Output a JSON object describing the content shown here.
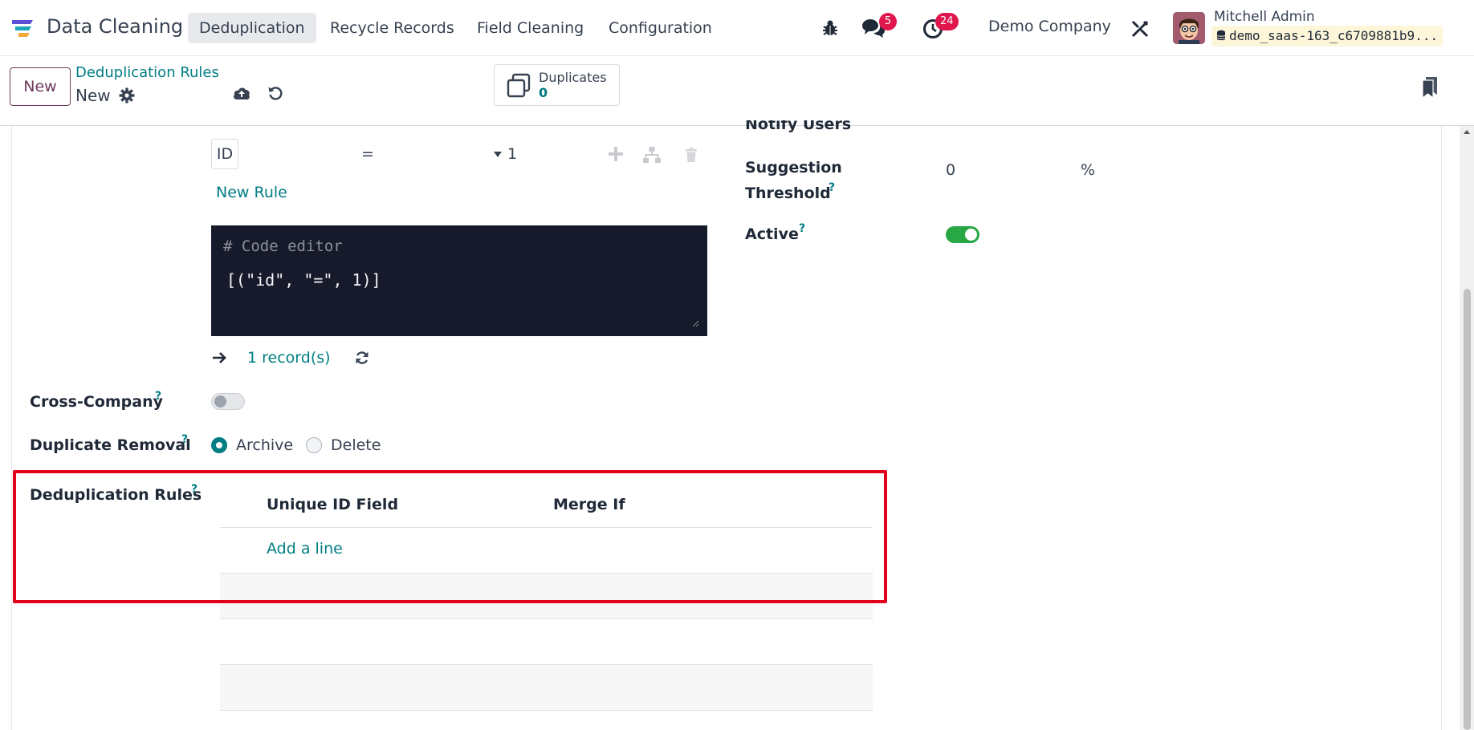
{
  "navbar": {
    "app_name": "Data Cleaning",
    "menu": [
      "Deduplication",
      "Recycle Records",
      "Field Cleaning",
      "Configuration"
    ],
    "active_menu": "Deduplication",
    "messages_badge": "5",
    "activities_badge": "24",
    "company": "Demo Company",
    "user_name": "Mitchell Admin",
    "database": "demo_saas-163_c6709881b9..."
  },
  "control": {
    "new_label": "New",
    "breadcrumb": "Deduplication Rules",
    "record_name": "New",
    "smart_button": {
      "label": "Duplicates",
      "count": "0"
    }
  },
  "domain_editor": {
    "field": "ID",
    "operator": "=",
    "value": "1",
    "new_rule": "New Rule",
    "code_comment": "# Code editor",
    "code": "[(\"id\", \"=\", 1)]",
    "record_count": "1 record(s)"
  },
  "right_fields": {
    "notify_users": "Notify Users",
    "suggestion_threshold_line1": "Suggestion",
    "suggestion_threshold_line2": "Threshold",
    "suggestion_value": "0",
    "suggestion_unit": "%",
    "active_label": "Active",
    "active_on": true
  },
  "left_fields": {
    "cross_company": "Cross-Company",
    "cross_company_on": false,
    "duplicate_removal": "Duplicate Removal",
    "removal_options": [
      "Archive",
      "Delete"
    ],
    "removal_selected": "Archive"
  },
  "dedup_rules": {
    "label": "Deduplication Rules",
    "columns": [
      "Unique ID Field",
      "Merge If"
    ],
    "add_line": "Add a line"
  },
  "help_mark": "?",
  "colors": {
    "primary": "#71385c",
    "link": "#017e84",
    "badge": "#e0174d",
    "toggle_on": "#28a745",
    "highlight": "#e3001b",
    "code_bg": "#171a2b"
  }
}
